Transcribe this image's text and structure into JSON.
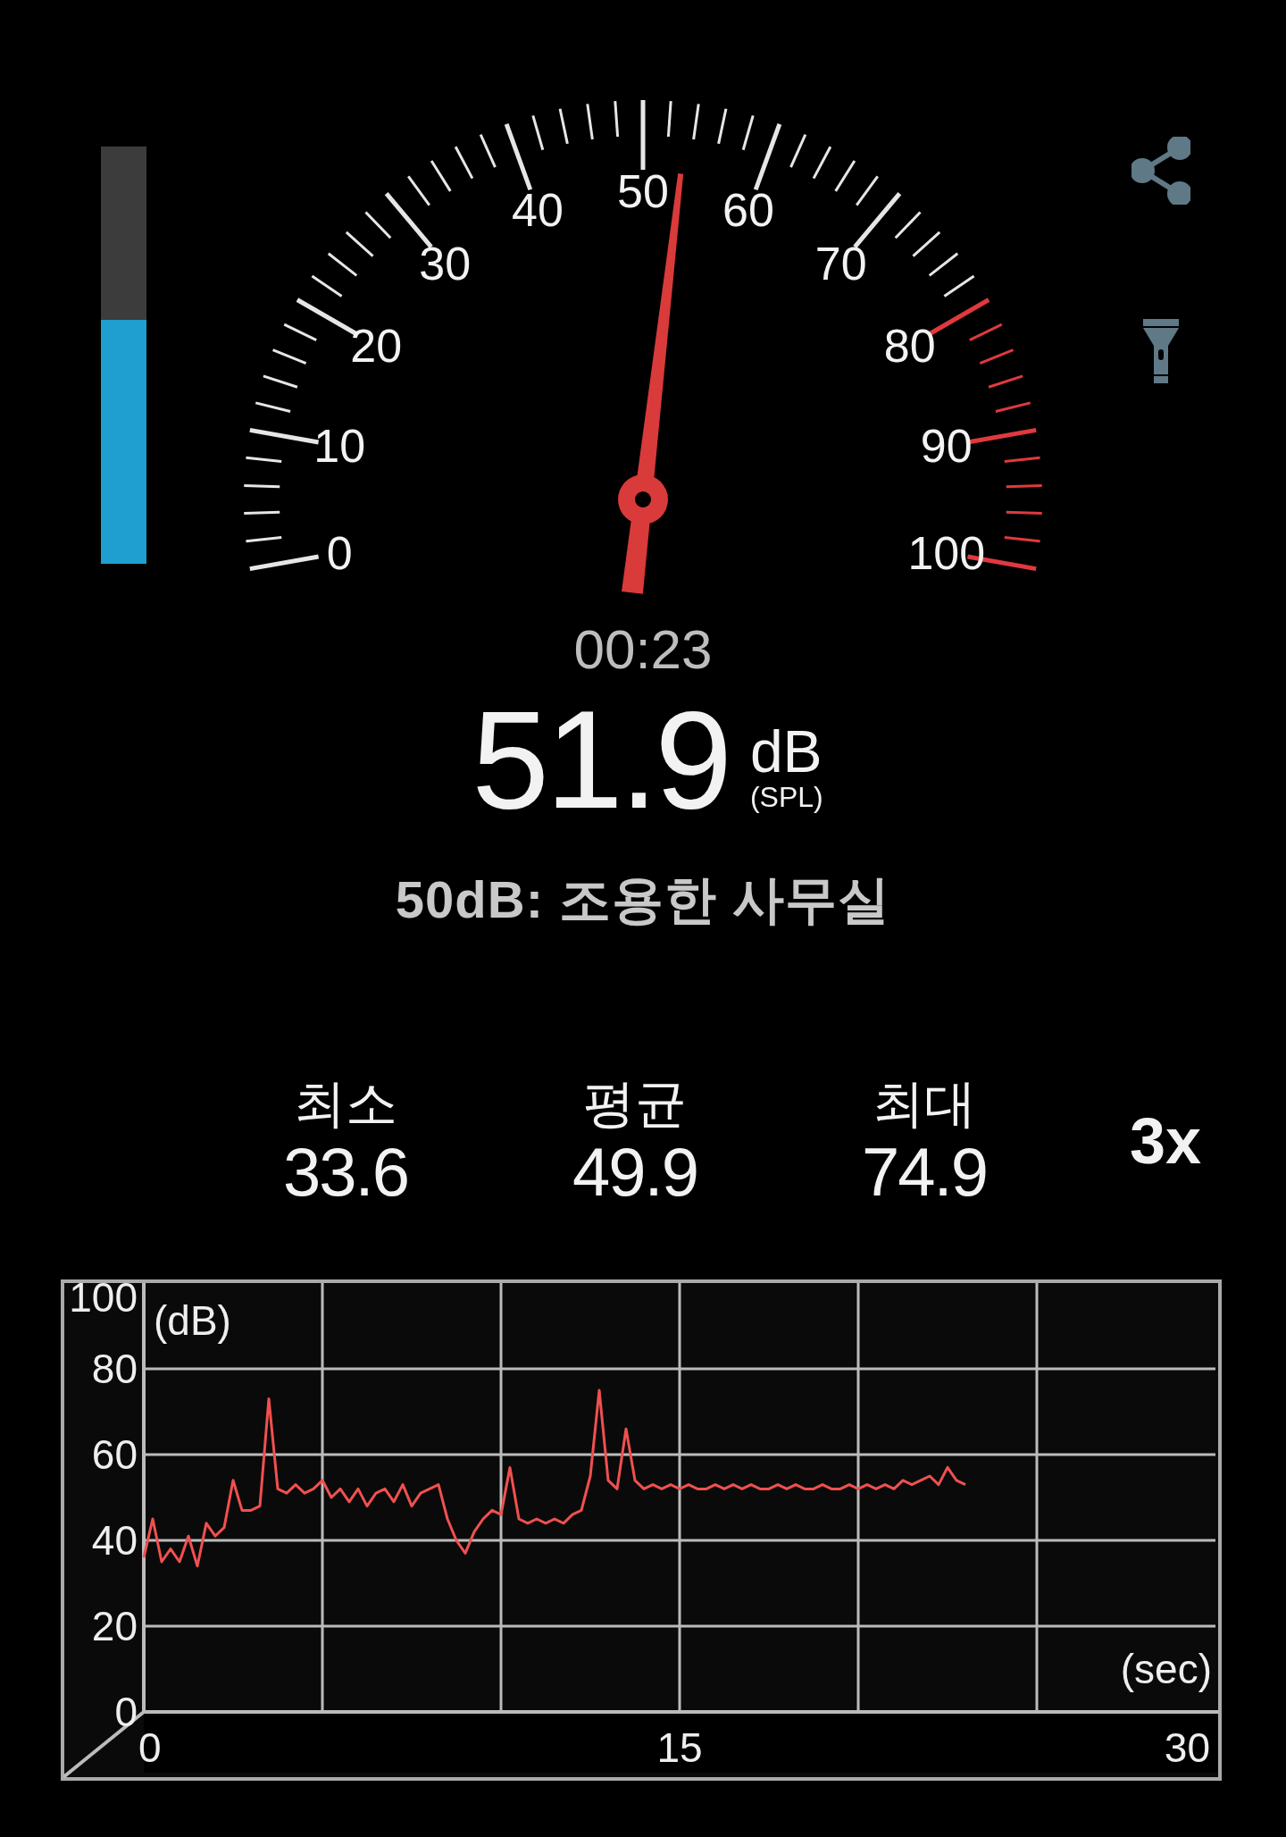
{
  "level_meter": {
    "level": 0.584
  },
  "gauge": {
    "labels": [
      "0",
      "10",
      "20",
      "30",
      "40",
      "50",
      "60",
      "70",
      "80",
      "90",
      "100"
    ]
  },
  "toolbar": [
    {
      "kind": "share"
    },
    {
      "kind": "flashlight"
    }
  ],
  "timer": "00:23",
  "reading": {
    "value": "51.9",
    "unit": "dB",
    "weighting": "(SPL)"
  },
  "description": "50dB: 조용한 사무실",
  "stats": [
    {
      "label": "최소",
      "value": "33.6"
    },
    {
      "label": "평균",
      "value": "49.9"
    },
    {
      "label": "최대",
      "value": "74.9"
    }
  ],
  "speed": "3x",
  "chart": {
    "chart_data": {
      "type": "line",
      "grid": true,
      "xlabel": "(sec)",
      "ylabel": "(dB)",
      "xlim": [
        0,
        30
      ],
      "ylim": [
        0,
        100
      ],
      "xticks": [
        0,
        15,
        30
      ],
      "yticks": [
        0,
        20,
        40,
        60,
        80,
        100
      ],
      "x": [
        0,
        0.25,
        0.5,
        0.75,
        1,
        1.25,
        1.5,
        1.75,
        2,
        2.25,
        2.5,
        2.75,
        3,
        3.25,
        3.5,
        3.75,
        4,
        4.25,
        4.5,
        4.75,
        5,
        5.25,
        5.5,
        5.75,
        6,
        6.25,
        6.5,
        6.75,
        7,
        7.25,
        7.5,
        7.75,
        8,
        8.25,
        8.5,
        8.75,
        9,
        9.25,
        9.5,
        9.75,
        10,
        10.25,
        10.5,
        10.75,
        11,
        11.25,
        11.5,
        11.75,
        12,
        12.25,
        12.5,
        12.75,
        13,
        13.25,
        13.5,
        13.75,
        14,
        14.25,
        14.5,
        14.75,
        15,
        15.25,
        15.5,
        15.75,
        16,
        16.25,
        16.5,
        16.75,
        17,
        17.25,
        17.5,
        17.75,
        18,
        18.25,
        18.5,
        18.75,
        19,
        19.25,
        19.5,
        19.75,
        20,
        20.25,
        20.5,
        20.75,
        21,
        21.25,
        21.5,
        21.75,
        22,
        22.25,
        22.5,
        22.75,
        23
      ],
      "series": [
        {
          "color": "#f05050",
          "values": [
            36,
            45,
            35,
            38,
            35,
            41,
            34,
            44,
            41,
            43,
            54,
            47,
            47,
            48,
            73,
            52,
            51,
            53,
            51,
            52,
            54,
            50,
            52,
            49,
            52,
            48,
            51,
            52,
            49,
            53,
            48,
            51,
            52,
            53,
            45,
            40,
            37,
            42,
            45,
            47,
            46,
            57,
            45,
            44,
            45,
            44,
            45,
            44,
            46,
            47,
            55,
            75,
            54,
            52,
            66,
            54,
            52,
            53,
            52,
            53,
            52,
            53,
            52,
            52,
            53,
            52,
            53,
            52,
            53,
            52,
            52,
            53,
            52,
            53,
            52,
            52,
            53,
            52,
            52,
            53,
            52,
            53,
            52,
            53,
            52,
            54,
            53,
            54,
            55,
            53,
            57,
            54,
            53
          ]
        }
      ]
    }
  }
}
